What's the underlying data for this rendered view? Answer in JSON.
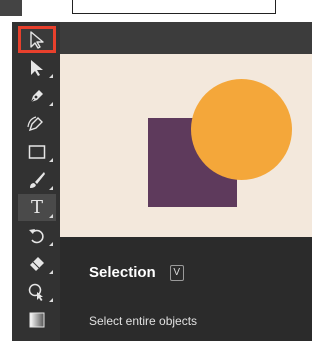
{
  "tooltip": {
    "title": "Selection",
    "shortcut": "V",
    "description": "Select entire objects"
  },
  "tools": [
    {
      "name": "selection-tool",
      "icon": "selection-arrow-icon",
      "selected": true
    },
    {
      "name": "direct-selection-tool",
      "icon": "direct-selection-arrow-icon"
    },
    {
      "name": "pen-tool",
      "icon": "pen-icon"
    },
    {
      "name": "curvature-tool",
      "icon": "curvature-pen-icon"
    },
    {
      "name": "rectangle-tool",
      "icon": "rectangle-icon"
    },
    {
      "name": "paintbrush-tool",
      "icon": "paintbrush-icon"
    },
    {
      "name": "type-tool",
      "icon": "type-icon",
      "label": "T"
    },
    {
      "name": "rotate-tool",
      "icon": "rotate-icon"
    },
    {
      "name": "eraser-tool",
      "icon": "eraser-icon"
    },
    {
      "name": "shape-builder-tool",
      "icon": "shape-builder-icon"
    },
    {
      "name": "gradient-tool",
      "icon": "gradient-icon"
    }
  ],
  "colors": {
    "toolbar_bg": "#323232",
    "selection_highlight": "#e8402c",
    "canvas_bg": "#f3e8dc",
    "rect_fill": "#5e3a5c",
    "circle_fill": "#f4a73a"
  }
}
